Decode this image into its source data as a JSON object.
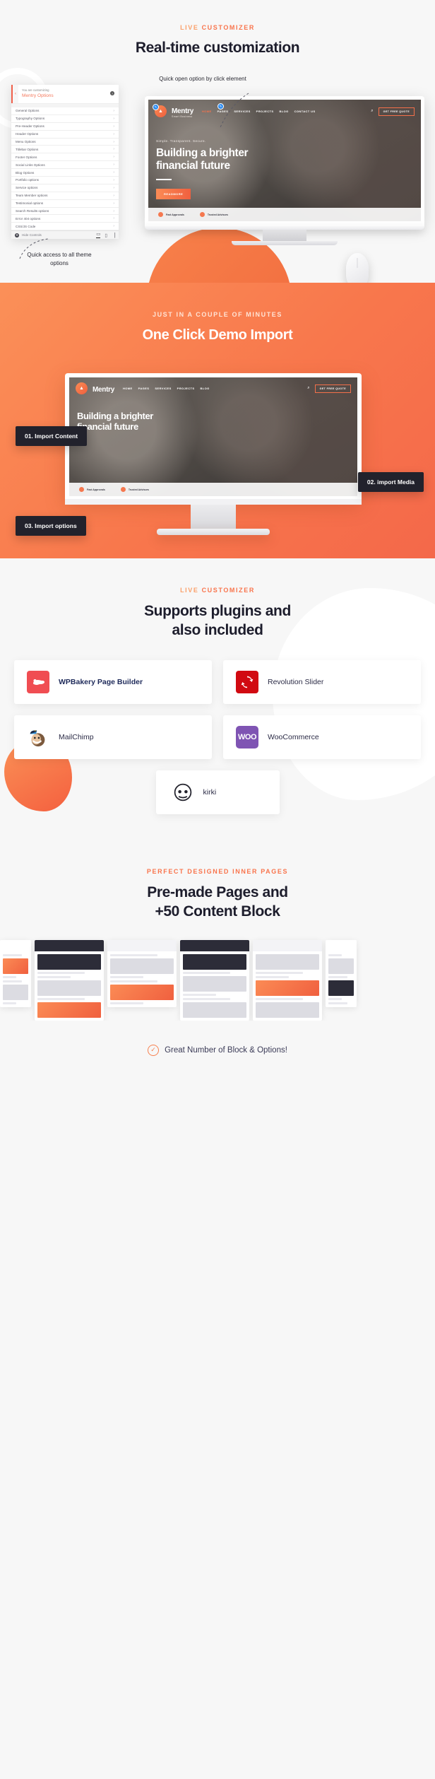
{
  "section_customizer": {
    "eyebrow_lead": "LIVE ",
    "eyebrow_rest": "CUSTOMIZER",
    "eyebrow_full": "LIVE CUSTOMIZER",
    "headline": "Real-time customization",
    "callout_top": "Quick open option by click element",
    "callout_bottom": "Quick access to all theme options",
    "panel": {
      "back_icon": "‹",
      "help_icon": "?",
      "customizing_label": "You are customizing",
      "panel_title": "Mentry Options",
      "chevron_icon": "›",
      "items": [
        {
          "label": "General Options"
        },
        {
          "label": "Typography Options"
        },
        {
          "label": "Pre-Header Options"
        },
        {
          "label": "Header Options"
        },
        {
          "label": "Menu Options"
        },
        {
          "label": "Titlebar Options"
        },
        {
          "label": "Footer Options"
        },
        {
          "label": "Social Links Options"
        },
        {
          "label": "Blog Options"
        },
        {
          "label": "Portfolio options"
        },
        {
          "label": "Service options"
        },
        {
          "label": "Team Member options"
        },
        {
          "label": "Testimonial options"
        },
        {
          "label": "Search Results options"
        },
        {
          "label": "Error 404 options"
        },
        {
          "label": "CSS/JS Code"
        }
      ],
      "footer": {
        "gear_icon": "⚙",
        "hide_controls": "Hide Controls",
        "desktop_icon": "▭",
        "tablet_icon": "▯",
        "mobile_icon": "▕"
      }
    },
    "site_preview": {
      "brand_name": "Mentry",
      "brand_tagline": "Smart Business",
      "logo_icon": "chart-icon",
      "menu": [
        "HOME",
        "PAGES",
        "SERVICES",
        "PROJECTS",
        "BLOG",
        "CONTACT US"
      ],
      "active_menu": "HOME",
      "search_icon": "⌕",
      "quote_button": "GET FREE QUOTE",
      "hero_kicker": "Simple. Transparent. Secure.",
      "hero_title_line1": "Building a brighter",
      "hero_title_line2": "financial future",
      "hero_button": "READMORE",
      "features": [
        "Fast Approvals",
        "Trusted Advisors"
      ],
      "pin_icon": "✎"
    }
  },
  "section_import": {
    "eyebrow": "JUST IN A COUPLE OF MINUTES",
    "headline": "One Click Demo Import",
    "steps": [
      {
        "label": "01. Import Content"
      },
      {
        "label": "02. import Media"
      },
      {
        "label": "03. Import options"
      }
    ],
    "site_preview": {
      "hero_title_line1": "Building a brighter",
      "hero_title_line2": "financial future",
      "brand_name": "Mentry",
      "menu": [
        "HOME",
        "PAGES",
        "SERVICES",
        "PROJECTS",
        "BLOG"
      ],
      "search_icon": "⌕",
      "quote_button": "GET FREE QUOTE",
      "features": [
        "Fast Approvals",
        "Trusted Advisors"
      ]
    }
  },
  "section_plugins": {
    "eyebrow_lead": "LIVE ",
    "eyebrow_rest": "CUSTOMIZER",
    "eyebrow_full": "LIVE CUSTOMIZER",
    "headline_line1": "Supports plugins and",
    "headline_line2": "also included",
    "plugins": [
      {
        "name": "WPBakery Page Builder",
        "icon": "wpbakery-icon",
        "color": "#f04d52"
      },
      {
        "name": "Revolution Slider",
        "icon": "revolution-slider-icon",
        "color": "#d10a11"
      },
      {
        "name": "MailChimp",
        "icon": "mailchimp-icon",
        "color": "#ffe01b"
      },
      {
        "name": "WooCommerce",
        "icon": "woocommerce-icon",
        "color": "#7f54b3"
      }
    ],
    "kirki": {
      "name": "kirki",
      "icon": "kirki-icon"
    }
  },
  "section_pages": {
    "eyebrow": "PERFECT DESIGNED INNER PAGES",
    "headline_line1": "Pre-made Pages and",
    "headline_line2": "+50 Content Block",
    "thumbnails": [
      {
        "name": "page-thumb-1"
      },
      {
        "name": "page-thumb-2"
      },
      {
        "name": "page-thumb-3"
      },
      {
        "name": "page-thumb-4"
      },
      {
        "name": "page-thumb-5"
      },
      {
        "name": "page-thumb-6"
      }
    ]
  },
  "footer": {
    "check_icon": "✓",
    "text": "Great Number of Block & Options!"
  },
  "colors": {
    "accent": "#f7804f",
    "accent_dark": "#f0603f",
    "navy": "#1e2a5a",
    "page_bg": "#f7f7f7"
  }
}
